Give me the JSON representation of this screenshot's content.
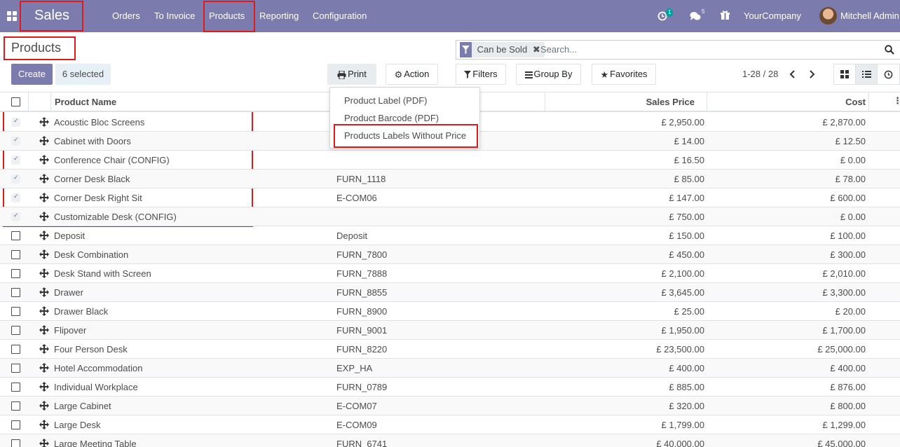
{
  "navbar": {
    "brand": "Sales",
    "menu": [
      "Orders",
      "To Invoice",
      "Products",
      "Reporting",
      "Configuration"
    ],
    "activity_count": "1",
    "messages_count": "5",
    "company": "YourCompany",
    "user": "Mitchell Admin"
  },
  "control": {
    "title": "Products",
    "create_label": "Create",
    "selected_label": "6 selected",
    "print_label": "Print",
    "action_label": "Action",
    "filters_label": "Filters",
    "groupby_label": "Group By",
    "favorites_label": "Favorites",
    "pager": "1-28 / 28"
  },
  "search": {
    "facet": "Can be Sold",
    "placeholder": "Search..."
  },
  "print_menu": [
    "Product Label (PDF)",
    "Product Barcode (PDF)",
    "Products Labels Without Price"
  ],
  "table": {
    "columns": {
      "name": "Product Name",
      "price": "Sales Price",
      "cost": "Cost"
    },
    "rows": [
      {
        "name": "Acoustic Bloc Screens",
        "ref": "",
        "price": "£ 2,950.00",
        "cost": "£ 2,870.00",
        "selected": true
      },
      {
        "name": "Cabinet with Doors",
        "ref": "",
        "price": "£ 14.00",
        "cost": "£ 12.50",
        "selected": true
      },
      {
        "name": "Conference Chair (CONFIG)",
        "ref": "",
        "price": "£ 16.50",
        "cost": "£ 0.00",
        "selected": true
      },
      {
        "name": "Corner Desk Black",
        "ref": "FURN_1118",
        "price": "£ 85.00",
        "cost": "£ 78.00",
        "selected": true
      },
      {
        "name": "Corner Desk Right Sit",
        "ref": "E-COM06",
        "price": "£ 147.00",
        "cost": "£ 600.00",
        "selected": true
      },
      {
        "name": "Customizable Desk (CONFIG)",
        "ref": "",
        "price": "£ 750.00",
        "cost": "£ 0.00",
        "selected": true
      },
      {
        "name": "Deposit",
        "ref": "Deposit",
        "price": "£ 150.00",
        "cost": "£ 100.00",
        "selected": false
      },
      {
        "name": "Desk Combination",
        "ref": "FURN_7800",
        "price": "£ 450.00",
        "cost": "£ 300.00",
        "selected": false
      },
      {
        "name": "Desk Stand with Screen",
        "ref": "FURN_7888",
        "price": "£ 2,100.00",
        "cost": "£ 2,010.00",
        "selected": false
      },
      {
        "name": "Drawer",
        "ref": "FURN_8855",
        "price": "£ 3,645.00",
        "cost": "£ 3,300.00",
        "selected": false
      },
      {
        "name": "Drawer Black",
        "ref": "FURN_8900",
        "price": "£ 25.00",
        "cost": "£ 20.00",
        "selected": false
      },
      {
        "name": "Flipover",
        "ref": "FURN_9001",
        "price": "£ 1,950.00",
        "cost": "£ 1,700.00",
        "selected": false
      },
      {
        "name": "Four Person Desk",
        "ref": "FURN_8220",
        "price": "£ 23,500.00",
        "cost": "£ 25,000.00",
        "selected": false
      },
      {
        "name": "Hotel Accommodation",
        "ref": "EXP_HA",
        "price": "£ 400.00",
        "cost": "£ 400.00",
        "selected": false
      },
      {
        "name": "Individual Workplace",
        "ref": "FURN_0789",
        "price": "£ 885.00",
        "cost": "£ 876.00",
        "selected": false
      },
      {
        "name": "Large Cabinet",
        "ref": "E-COM07",
        "price": "£ 320.00",
        "cost": "£ 800.00",
        "selected": false
      },
      {
        "name": "Large Desk",
        "ref": "E-COM09",
        "price": "£ 1,799.00",
        "cost": "£ 1,299.00",
        "selected": false
      },
      {
        "name": "Large Meeting Table",
        "ref": "FURN_6741",
        "price": "£ 40,000.00",
        "cost": "£ 45,000.00",
        "selected": false
      }
    ]
  }
}
